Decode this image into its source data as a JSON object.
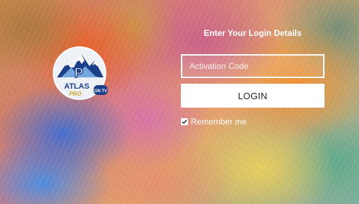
{
  "background": {
    "style": "colorful-abstract-blur"
  },
  "logo": {
    "brand_text": "ATLAS",
    "sub_text": "PRO",
    "badge_text": "ON TV",
    "letter_mark": "P",
    "icon": "mountain-logo-icon"
  },
  "login": {
    "title": "Enter Your Login Details",
    "activation_placeholder": "Activation Code",
    "activation_value": "",
    "button_label": "LOGIN",
    "remember_label": "Remember me",
    "remember_checked": true
  },
  "colors": {
    "button_background": "#ffffff",
    "button_text": "#222222",
    "text": "#ffffff",
    "logo_dark_blue": "#1d3f8a",
    "logo_light_blue": "#7fb3e8"
  }
}
